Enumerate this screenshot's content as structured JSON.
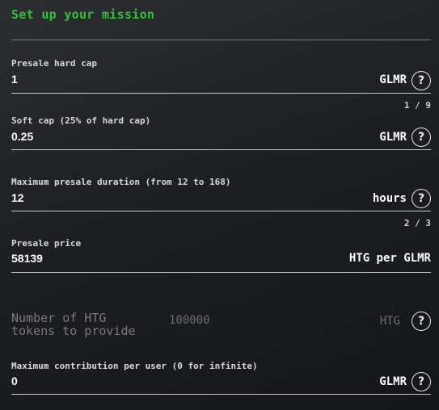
{
  "title": "Set up your mission",
  "fields": {
    "hard_cap": {
      "label": "Presale hard cap",
      "value": "1",
      "unit": "GLMR",
      "pager": "1 / 9"
    },
    "soft_cap": {
      "label": "Soft cap (25% of hard cap)",
      "value": "0.25",
      "unit": "GLMR"
    },
    "duration": {
      "label": "Maximum presale duration (from 12 to 168)",
      "value": "12",
      "unit": "hours",
      "pager": "2 / 3"
    },
    "price": {
      "label": "Presale price",
      "value": "58139",
      "unit": "HTG per GLMR"
    },
    "tokens": {
      "label_line1": "Number of HTG",
      "label_line2": "tokens to provide",
      "value": "100000",
      "unit": "HTG"
    },
    "max_contribution": {
      "label": "Maximum contribution per user (0 for infinite)",
      "value": "0",
      "unit": "GLMR"
    }
  },
  "help_symbol": "?",
  "colors": {
    "accent": "#2fc33a",
    "background": "#1d1f22",
    "muted": "#7a7a7a"
  }
}
